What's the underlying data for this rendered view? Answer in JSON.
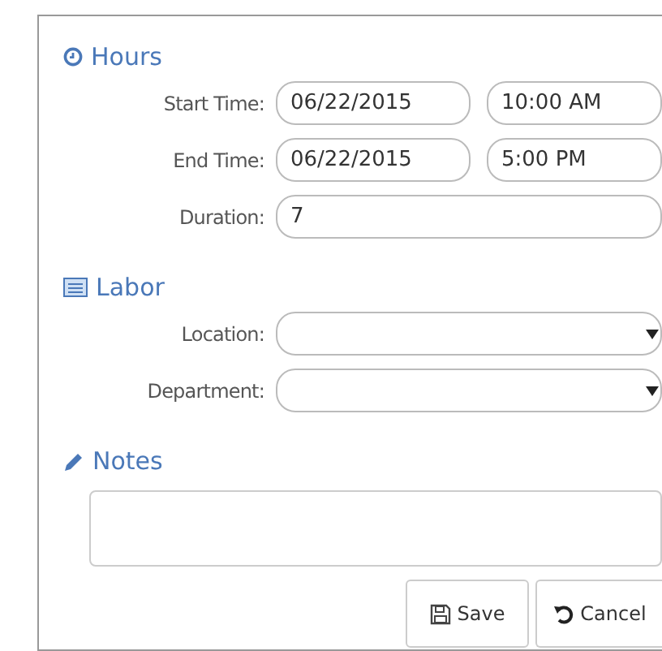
{
  "sections": [
    {
      "kind": "hours",
      "title": "Hours",
      "rows": [
        {
          "label": "Start Time:",
          "fields": [
            {
              "kind": "date",
              "value": "06/22/2015"
            },
            {
              "kind": "time",
              "value": "10:00 AM"
            }
          ]
        },
        {
          "label": "End Time:",
          "fields": [
            {
              "kind": "date",
              "value": "06/22/2015"
            },
            {
              "kind": "time",
              "value": "5:00 PM"
            }
          ]
        },
        {
          "label": "Duration:",
          "fields": [
            {
              "kind": "text",
              "value": "7"
            }
          ]
        }
      ]
    },
    {
      "kind": "labor",
      "title": "Labor",
      "rows": [
        {
          "label": "Location:",
          "fields": [
            {
              "kind": "select"
            }
          ]
        },
        {
          "label": "Department:",
          "fields": [
            {
              "kind": "select"
            }
          ]
        }
      ]
    },
    {
      "kind": "notes",
      "title": "Notes"
    }
  ],
  "buttons": [
    {
      "kind": "save",
      "label": "Save"
    },
    {
      "kind": "cancel",
      "label": "Cancel"
    }
  ]
}
